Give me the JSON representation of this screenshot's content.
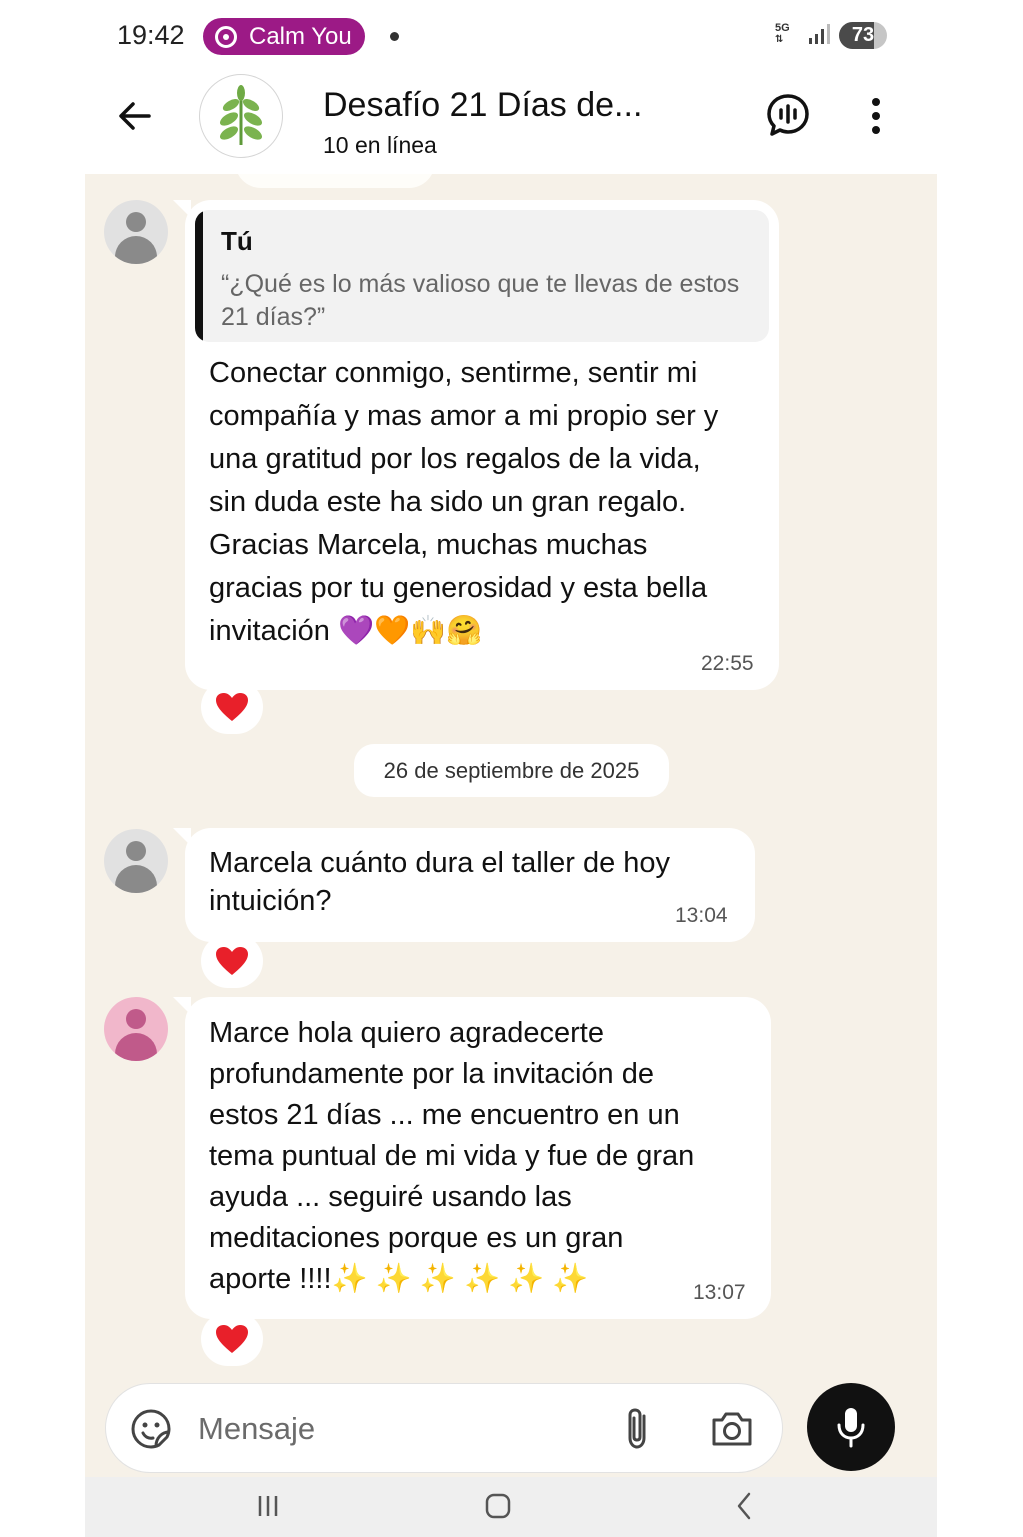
{
  "status_bar": {
    "time": "19:42",
    "notification_pill": "Calm You",
    "network": "5G",
    "battery": "73",
    "battery_level": 0.73
  },
  "header": {
    "title": "Desafío 21 Días de...",
    "subtitle": "10 en línea",
    "avatar_icon": "herb-icon"
  },
  "messages": [
    {
      "quote_author": "Tú",
      "quote_text": "“¿Qué es lo más valioso que te llevas de estos 21 días?”",
      "text": "Conectar conmigo, sentirme, sentir mi compañía y mas amor a mi propio ser y una gratitud por los regalos de la vida, sin duda este ha sido un gran regalo. Gracias Marcela, muchas muchas gracias por tu generosidad y esta bella invitación 💜🧡🙌🤗",
      "time": "22:55",
      "reaction": "❤️"
    },
    {
      "text": "Marcela cuánto dura el taller de hoy intuición?",
      "time": "13:04",
      "reaction": "❤️"
    },
    {
      "text": "Marce hola quiero agradecerte profundamente por la invitación de estos 21 días ... me encuentro en un tema puntual de mi vida y fue de gran ayuda ... seguiré usando las meditaciones porque es un gran aporte !!!!✨ ✨ ✨ ✨ ✨ ✨",
      "time": "13:07",
      "reaction": "❤️"
    }
  ],
  "date_separator": "26 de septiembre de 2025",
  "input": {
    "placeholder": "Mensaje",
    "value": ""
  },
  "icons": {
    "back": "arrow-left-icon",
    "voice_chat": "voice-chat-icon",
    "more": "more-vertical-icon",
    "emoji": "sticker-emoji-icon",
    "attach": "paperclip-icon",
    "camera": "camera-icon",
    "mic": "microphone-icon"
  },
  "colors": {
    "pill": "#9c1a86",
    "chat_background": "#f6f1e8",
    "mic_button": "#111111",
    "reaction_heart": "#e8202a"
  }
}
